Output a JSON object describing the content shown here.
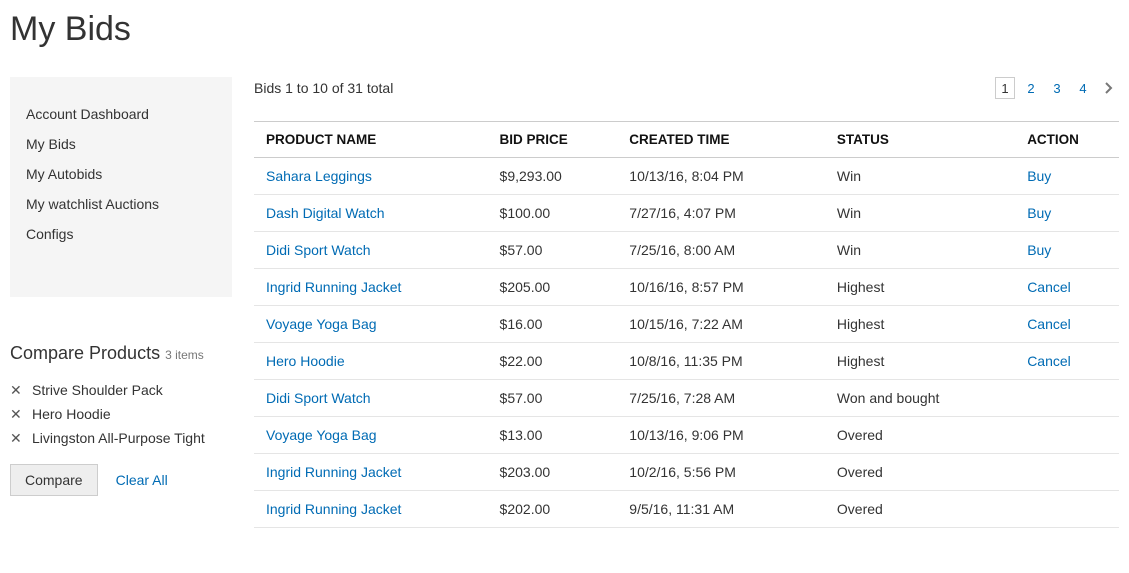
{
  "page": {
    "title": "My Bids"
  },
  "sidebar": {
    "nav": [
      {
        "label": "Account Dashboard"
      },
      {
        "label": "My Bids"
      },
      {
        "label": "My Autobids"
      },
      {
        "label": "My watchlist Auctions"
      },
      {
        "label": "Configs"
      }
    ]
  },
  "compare": {
    "title": "Compare Products",
    "count_label": "3 items",
    "items": [
      {
        "name": "Strive Shoulder Pack"
      },
      {
        "name": "Hero Hoodie"
      },
      {
        "name": "Livingston All-Purpose Tight"
      }
    ],
    "compare_button": "Compare",
    "clear_all": "Clear All"
  },
  "toolbar": {
    "amount_text": "Bids 1 to 10 of 31 total",
    "pages": [
      "1",
      "2",
      "3",
      "4"
    ],
    "current_page": "1"
  },
  "table": {
    "headers": {
      "product": "PRODUCT NAME",
      "price": "BID PRICE",
      "time": "CREATED TIME",
      "status": "STATUS",
      "action": "ACTION"
    },
    "rows": [
      {
        "product": "Sahara Leggings",
        "price": "$9,293.00",
        "time": "10/13/16, 8:04 PM",
        "status": "Win",
        "action": "Buy"
      },
      {
        "product": "Dash Digital Watch",
        "price": "$100.00",
        "time": "7/27/16, 4:07 PM",
        "status": "Win",
        "action": "Buy"
      },
      {
        "product": "Didi Sport Watch",
        "price": "$57.00",
        "time": "7/25/16, 8:00 AM",
        "status": "Win",
        "action": "Buy"
      },
      {
        "product": "Ingrid Running Jacket",
        "price": "$205.00",
        "time": "10/16/16, 8:57 PM",
        "status": "Highest",
        "action": "Cancel"
      },
      {
        "product": "Voyage Yoga Bag",
        "price": "$16.00",
        "time": "10/15/16, 7:22 AM",
        "status": "Highest",
        "action": "Cancel"
      },
      {
        "product": "Hero Hoodie",
        "price": "$22.00",
        "time": "10/8/16, 11:35 PM",
        "status": "Highest",
        "action": "Cancel"
      },
      {
        "product": "Didi Sport Watch",
        "price": "$57.00",
        "time": "7/25/16, 7:28 AM",
        "status": "Won and bought",
        "action": ""
      },
      {
        "product": "Voyage Yoga Bag",
        "price": "$13.00",
        "time": "10/13/16, 9:06 PM",
        "status": "Overed",
        "action": ""
      },
      {
        "product": "Ingrid Running Jacket",
        "price": "$203.00",
        "time": "10/2/16, 5:56 PM",
        "status": "Overed",
        "action": ""
      },
      {
        "product": "Ingrid Running Jacket",
        "price": "$202.00",
        "time": "9/5/16, 11:31 AM",
        "status": "Overed",
        "action": ""
      }
    ]
  }
}
